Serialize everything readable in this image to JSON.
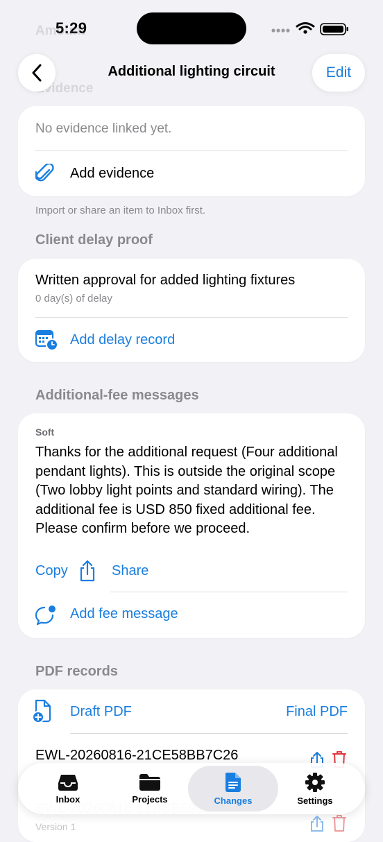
{
  "status_bar": {
    "time": "5:29"
  },
  "nav": {
    "title": "Additional lighting circuit",
    "edit_label": "Edit",
    "ghost_top": "Amount",
    "ghost_evidence": "Evidence"
  },
  "evidence": {
    "empty_text": "No evidence linked yet.",
    "add_label": "Add evidence",
    "footnote": "Import or share an item to Inbox first."
  },
  "delay": {
    "header": "Client delay proof",
    "item_title": "Written approval for added lighting fixtures",
    "item_subtitle": "0 day(s) of delay",
    "add_label": "Add delay record"
  },
  "fee_messages": {
    "header": "Additional-fee messages",
    "tone": "Soft",
    "message": "Thanks for the additional request (Four additional pendant lights). This is outside the original scope (Two lobby light points and standard wiring). The additional fee is USD 850 fixed additional fee. Please confirm before we proceed.",
    "copy_label": "Copy",
    "share_label": "Share",
    "add_label": "Add fee message"
  },
  "pdf": {
    "header": "PDF records",
    "draft_label": "Draft PDF",
    "final_label": "Final PDF",
    "record1": "EWL-20260816-21CE58BB7C26",
    "record2": "EWL-20260816-12BCB598DA96",
    "record2_sub": "Version 1"
  },
  "tabs": [
    {
      "label": "Inbox",
      "icon": "tray-icon"
    },
    {
      "label": "Projects",
      "icon": "folder-icon"
    },
    {
      "label": "Changes",
      "icon": "document-icon",
      "active": true
    },
    {
      "label": "Settings",
      "icon": "gear-icon"
    }
  ],
  "colors": {
    "accent": "#1a7ee0",
    "destructive": "#e0383e",
    "background": "#f2f2f6"
  }
}
